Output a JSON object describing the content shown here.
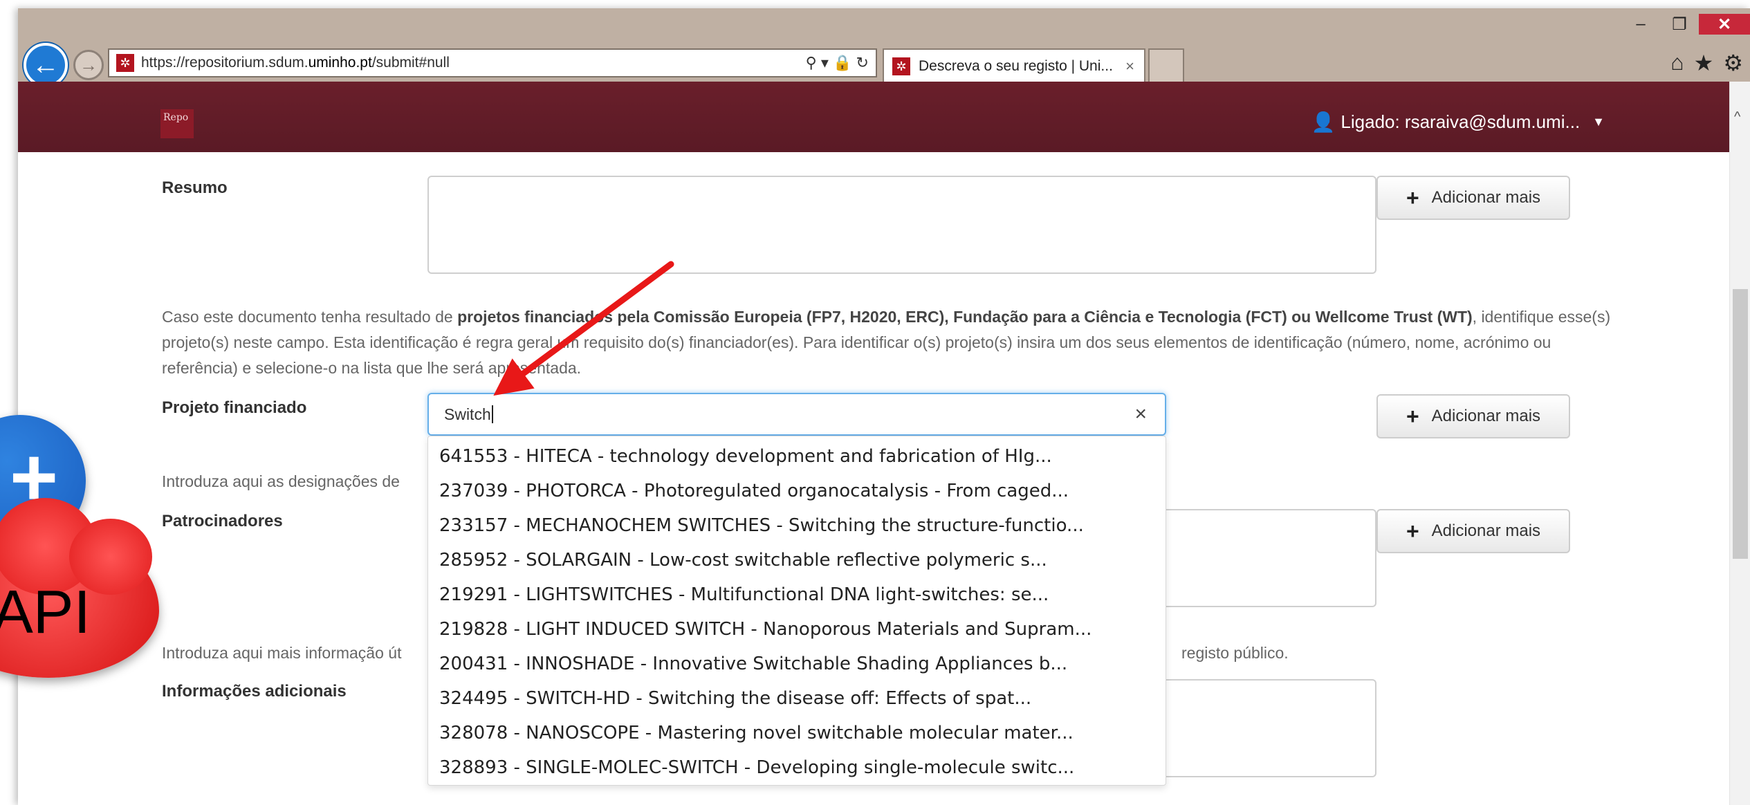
{
  "browser": {
    "url_prefix": "https://repositorium.sdum.",
    "url_domain": "uminho.pt",
    "url_path": "/submit#null",
    "tab_title": "Descreva o seu registo | Uni...",
    "tab_close": "×",
    "address_tools": "⚲ ▾ 🔒 ↻",
    "window_minimize": "–",
    "window_restore": "❐",
    "window_close": "✕",
    "icons": [
      "home-icon",
      "star-icon",
      "gear-icon"
    ]
  },
  "header": {
    "logo_text": "Repo",
    "user_label": "Ligado: rsaraiva@sdum.umi..."
  },
  "form": {
    "resumo_label": "Resumo",
    "add_more_label": "Adicionar mais",
    "projeto_help_pre": "Caso este documento tenha resultado de ",
    "projeto_help_bold1": "projetos financiados pela Comissão Europeia (FP7, H2020, ERC), Fundação para a Ciência e Tecnologia (FCT) ou Wellcome Trust (WT)",
    "projeto_help_post": ", identifique esse(s) projeto(s) neste campo. Esta identificação é regra geral um requisito do(s) financiador(es). Para identificar o(s) projeto(s) insira um dos seus elementos de identificação (número, nome, acrónimo ou referência) e selecione-o na lista que lhe será apresentada.",
    "projeto_label": "Projeto financiado",
    "projeto_value": "Switch",
    "patrocinadores_help": "Introduza aqui as designações de",
    "patrocinadores_label": "Patrocinadores",
    "info_help_pre": "Introduza aqui mais informação út",
    "info_help_post": "registo público.",
    "info_label": "Informações adicionais"
  },
  "suggestions": [
    "641553 - HITECA - technology development and fabrication of HIg...",
    "237039 - PHOTORCA - Photoregulated organocatalysis - From caged...",
    "233157 - MECHANOCHEM SWITCHES - Switching the structure-functio...",
    "285952 - SOLARGAIN - Low-cost switchable reflective polymeric s...",
    "219291 - LIGHTSWITCHES - Multifunctional DNA light-switches: se...",
    "219828 - LIGHT INDUCED SWITCH - Nanoporous Materials and Supram...",
    "200431 - INNOSHADE - Innovative Switchable Shading Appliances b...",
    "324495 - SWITCH-HD - Switching the disease off: Effects of spat...",
    "328078 - NANOSCOPE - Mastering novel switchable molecular mater...",
    "328893 - SINGLE-MOLEC-SWITCH - Developing single-molecule switc..."
  ],
  "overlay": {
    "plus_symbol": "+",
    "api_label": "API",
    "arrow_color": "#e81818"
  }
}
